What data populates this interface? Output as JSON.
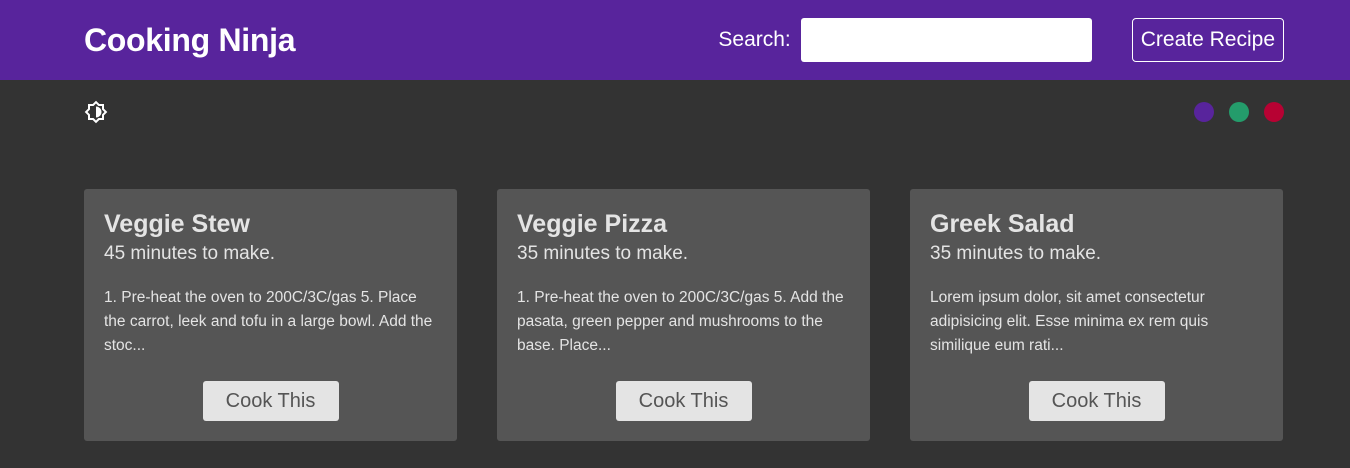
{
  "navbar": {
    "brand": "Cooking Ninja",
    "search_label": "Search:",
    "search_value": "",
    "create_label": "Create Recipe",
    "color": "#58249c"
  },
  "theme": {
    "mode_icon": "brightness-toggle-icon",
    "swatches": [
      {
        "name": "purple",
        "color": "#58249c"
      },
      {
        "name": "green",
        "color": "#249c6b"
      },
      {
        "name": "red",
        "color": "#b70233"
      }
    ]
  },
  "recipes": [
    {
      "title": "Veggie Stew",
      "time": "45 minutes to make.",
      "method": "1. Pre-heat the oven to 200C/3C/gas 5. Place the carrot, leek and tofu in a large bowl. Add the stoc...",
      "button": "Cook This"
    },
    {
      "title": "Veggie Pizza",
      "time": "35 minutes to make.",
      "method": "1. Pre-heat the oven to 200C/3C/gas 5. Add the pasata, green pepper and mushrooms to the base. Place...",
      "button": "Cook This"
    },
    {
      "title": "Greek Salad",
      "time": "35 minutes to make.",
      "method": "Lorem ipsum dolor, sit amet consectetur adipisicing elit. Esse minima ex rem quis similique eum rati...",
      "button": "Cook This"
    }
  ]
}
